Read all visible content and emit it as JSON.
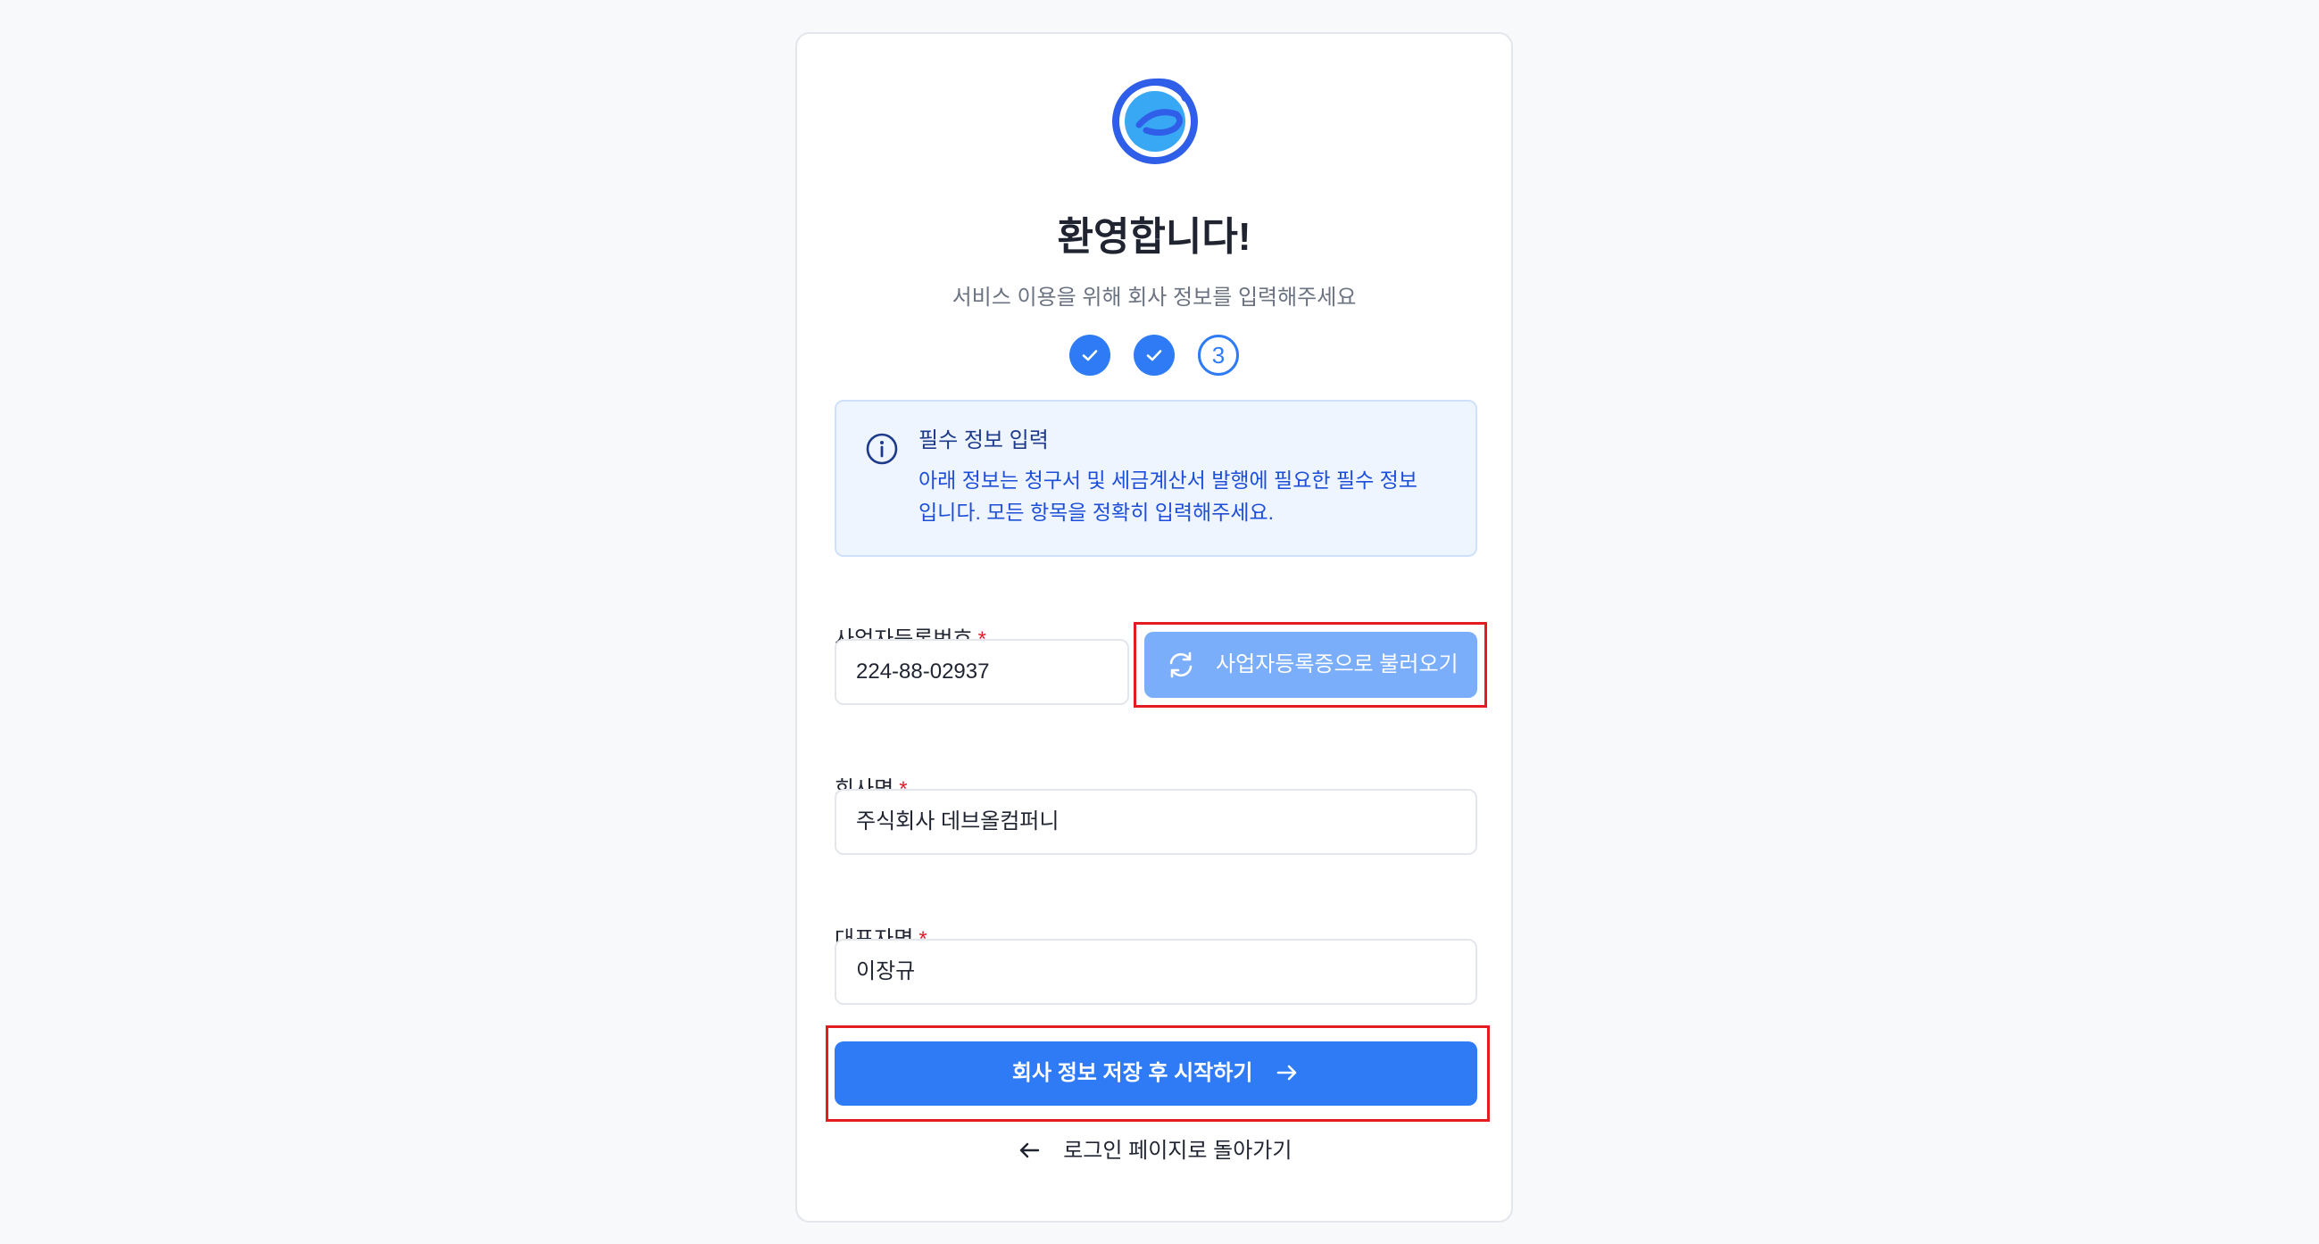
{
  "header": {
    "title": "환영합니다!",
    "subtitle": "서비스 이용을 위해 회사 정보를 입력해주세요"
  },
  "steps": {
    "items": [
      {
        "state": "done",
        "icon": "check-icon"
      },
      {
        "state": "done",
        "icon": "check-icon"
      },
      {
        "state": "current",
        "label": "3"
      }
    ]
  },
  "info": {
    "icon": "info-icon",
    "title": "필수 정보 입력",
    "line1": "아래 정보는 청구서 및 세금계산서 발행에 필요한 필수 정보",
    "line2": "입니다. 모든 항목을 정확히 입력해주세요."
  },
  "form": {
    "business_number": {
      "label": "사업자등록번호",
      "required_mark": "*",
      "value": "224-88-02937"
    },
    "load_button": {
      "label": "사업자등록증으로 불러오기",
      "icon": "refresh-icon"
    },
    "company_name": {
      "label": "회사명",
      "required_mark": "*",
      "value": "주식회사 데브올컴퍼니"
    },
    "ceo_name": {
      "label": "대표자명",
      "required_mark": "*",
      "value": "이장규"
    },
    "submit_button": {
      "label": "회사 정보 저장 후 시작하기",
      "icon": "arrow-right-icon"
    }
  },
  "footer": {
    "back_link": "로그인 페이지로 돌아가기",
    "icon": "arrow-left-icon"
  },
  "colors": {
    "primary": "#2f7bf5",
    "primary_light": "#7aadfa",
    "required": "#e11d2e",
    "highlight": "#e31b23",
    "info_bg": "#eef5ff"
  }
}
